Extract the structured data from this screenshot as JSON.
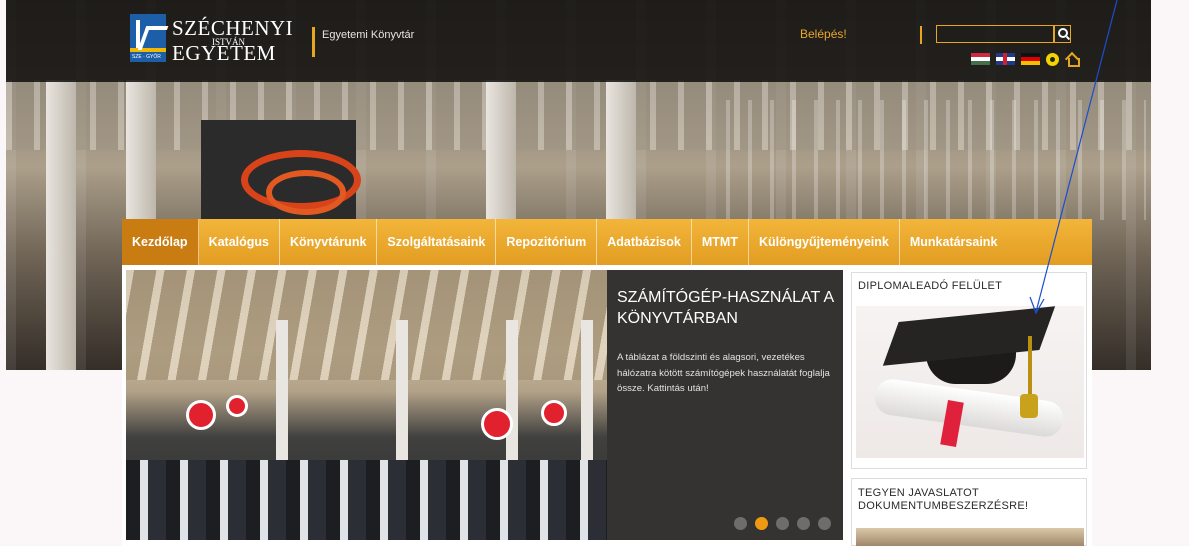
{
  "header": {
    "logo": {
      "line1": "SZÉCHENYI",
      "line2": "EGYETEM",
      "line3": "ISTVÁN",
      "mark_text": "SZE · GYŐR"
    },
    "department": "Egyetemi Könyvtár",
    "login_label": "Belépés!",
    "search": {
      "value": "",
      "placeholder": ""
    },
    "flags": [
      "hungarian-flag",
      "english-flag",
      "german-flag"
    ],
    "accent_color": "#e6a61f"
  },
  "nav": {
    "items": [
      {
        "label": "Kezdőlap",
        "active": true
      },
      {
        "label": "Katalógus"
      },
      {
        "label": "Könyvtárunk"
      },
      {
        "label": "Szolgáltatásaink"
      },
      {
        "label": "Repozitórium"
      },
      {
        "label": "Adatbázisok"
      },
      {
        "label": "MTMT"
      },
      {
        "label": "Különgyűjteményeink"
      },
      {
        "label": "Munkatársaink"
      }
    ],
    "color": "#eba52c"
  },
  "slider": {
    "title": "SZÁMÍTÓGÉP-HASZNÁLAT A KÖNYVTÁRBAN",
    "text": "A táblázat a földszinti és alagsori, vezetékes hálózatra kötött számítógépek használatát foglalja össze. Kattintás után!",
    "dots": 5,
    "active_dot": 2
  },
  "sidebar": {
    "box1_title": "DIPLOMALEADÓ FELÜLET",
    "box2_title": "TEGYEN JAVASLATOT DOKUMENTUMBESZERZÉSRE!"
  }
}
